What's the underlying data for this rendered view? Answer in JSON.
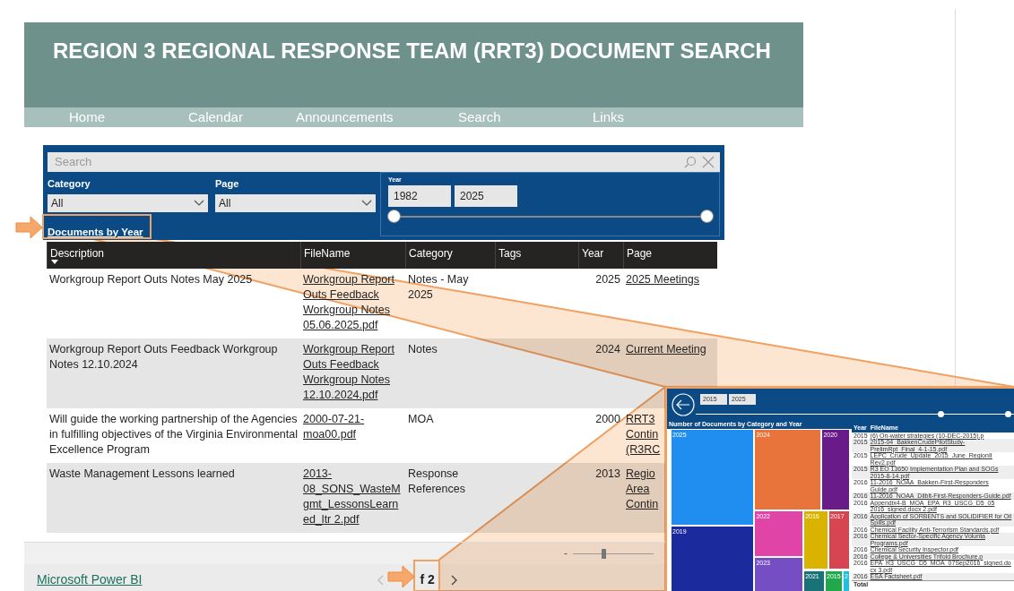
{
  "header": {
    "title": "REGION 3 REGIONAL RESPONSE TEAM (RRT3) DOCUMENT SEARCH"
  },
  "nav": [
    {
      "label": "Home"
    },
    {
      "label": "Calendar"
    },
    {
      "label": "Announcements"
    },
    {
      "label": "Search"
    },
    {
      "label": "Links"
    }
  ],
  "report": {
    "search": {
      "placeholder": "Search"
    },
    "filters": [
      {
        "label": "Category",
        "value": "All"
      },
      {
        "label": "Page",
        "value": "All"
      }
    ],
    "year_filter": {
      "label": "Year",
      "from": "1982",
      "to": "2025",
      "level": 1
    },
    "link": "Documents by Year",
    "table": {
      "columns": [
        {
          "label": "Description",
          "sorted": true
        },
        {
          "label": "FileName",
          "sorted": false
        },
        {
          "label": "Category",
          "sorted": false
        },
        {
          "label": "Tags",
          "sorted": false
        },
        {
          "label": "Year",
          "sorted": false
        },
        {
          "label": "Page",
          "sorted": false
        }
      ],
      "rows": [
        {
          "description": "Workgroup Report Outs Notes May 2025",
          "file_name": "Workgroup Report Outs Feedback Workgroup Notes 05.06.2025.pdf",
          "category": "Notes - May 2025",
          "year": "2025",
          "page": "2025 Meetings"
        },
        {
          "description": "Workgroup Report Outs Feedback Workgroup Notes 12.10.2024",
          "file_name": "Workgroup Report Outs Feedback Workgroup Notes 12.10.2024.pdf",
          "category": "Notes",
          "year": "2024",
          "page": "Current Meeting"
        },
        {
          "description": "Will guide the working partnership of the Agencies in fulfilling objectives of the Virginia Environmental Excellence Program",
          "file_name": "2000-07-21-moa00.pdf",
          "category": "MOA",
          "year": "2000",
          "page": "RRT3 Contin (R3RC"
        },
        {
          "description": "Waste Management Lessons learned",
          "file_name": "2013-08_SONS_WasteMgmt_LessonsLearned_ltr 2.pdf",
          "category": "Response References",
          "year": "2013",
          "page": "Regio Area Contin"
        }
      ]
    },
    "zoom": {
      "label": "-",
      "level": 0.35
    },
    "footer": {
      "brand": "Microsoft Power BI",
      "pager": "f 2"
    }
  },
  "inset": {
    "from": "2015",
    "to": "2025",
    "level": 0.77,
    "title": "Number of Documents by Category and Year",
    "tiles": [
      {
        "year": "2025",
        "color": "#1f8ef0"
      },
      {
        "year": "2019",
        "color": "#1b2a9c"
      },
      {
        "year": "2024",
        "color": "#e8743b"
      },
      {
        "year": "2020",
        "color": "#6a1b8a"
      },
      {
        "year": "2022",
        "color": "#e044a7"
      },
      {
        "year": "2023",
        "color": "#744ec2"
      },
      {
        "year": "2016",
        "color": "#d9b300"
      },
      {
        "year": "2017",
        "color": "#d64550"
      },
      {
        "year": "2021",
        "color": "#197278"
      },
      {
        "year": "2015",
        "color": "#21a84a"
      },
      {
        "year": "2",
        "color": "#19c1e6"
      }
    ],
    "list": {
      "columns": [
        "Year",
        "FileName"
      ],
      "rows": [
        {
          "year": "2015",
          "file": "(6) On-water strategies (10-DEC-2015).p"
        },
        {
          "year": "2015",
          "file": "2015-04_BakkenCrudePilotStudy-PrelimRpt_Final_4-1-15.pdf"
        },
        {
          "year": "2015",
          "file": "LEPC_Crude_Update_2015_June_RegionII Rev2.pdf"
        },
        {
          "year": "2015",
          "file": "R3 EO 13650 Implementation Plan and SOGs 2015-8-14.pdf"
        },
        {
          "year": "2016",
          "file": "11-2016_NOAA_Bakken-First-Responders Guide.pdf"
        },
        {
          "year": "2016",
          "file": "11-2016_NOAA_Dilbit-First-Responders-Guide.pdf"
        },
        {
          "year": "2016",
          "file": "Appendix4-B_MOA_EPA_R3_USCG_D5_05 2016_signed.docx 2.pdf"
        },
        {
          "year": "2016",
          "file": "Application of SORBENTS and SOLIDIFIER for Oil Spills.pdf"
        },
        {
          "year": "2016",
          "file": "Chemical Facility Anti-Terrorism Standards.pdf"
        },
        {
          "year": "2016",
          "file": "Chemical Sector-Specific Agency Volunta Programs.pdf"
        },
        {
          "year": "2016",
          "file": "Chemical Security Inspector.pdf"
        },
        {
          "year": "2016",
          "file": "College & Universities Trifold Brochure.p"
        },
        {
          "year": "2016",
          "file": "EPA_R3_USCG_D5_MOA_07Sep2016_signed.docx 3.pdf"
        },
        {
          "year": "2016",
          "file": "ESA Factsheet.pdf"
        }
      ],
      "total": "Total"
    }
  }
}
